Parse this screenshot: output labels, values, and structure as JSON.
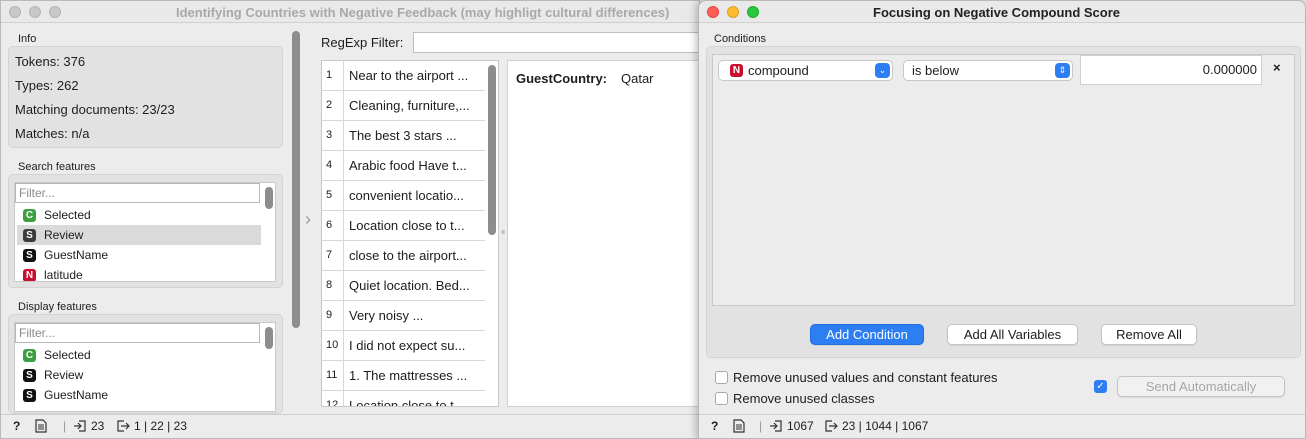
{
  "corpus_viewer": {
    "title": "Identifying Countries with Negative Feedback (may highligt cultural differences)",
    "info": {
      "heading": "Info",
      "tokens": "Tokens: 376",
      "types": "Types: 262",
      "matching_documents": "Matching documents: 23/23",
      "matches": "Matches: n/a"
    },
    "search_features": {
      "heading": "Search features",
      "filter_placeholder": "Filter...",
      "items": [
        {
          "badge": "C",
          "label": "Selected",
          "color": "#3aa041"
        },
        {
          "badge": "S",
          "label": "Review",
          "color": "#3b3b3b"
        },
        {
          "badge": "S",
          "label": "GuestName",
          "color": "#111111"
        },
        {
          "badge": "N",
          "label": "latitude",
          "color": "#c8102e"
        }
      ]
    },
    "display_features": {
      "heading": "Display features",
      "filter_placeholder": "Filter...",
      "items": [
        {
          "badge": "C",
          "label": "Selected",
          "color": "#3aa041"
        },
        {
          "badge": "S",
          "label": "Review",
          "color": "#111111"
        },
        {
          "badge": "S",
          "label": "GuestName",
          "color": "#111111"
        }
      ]
    },
    "regexp_label": "RegExp Filter:",
    "regexp_value": "",
    "documents": [
      {
        "n": "1",
        "text": "Near to the airport ..."
      },
      {
        "n": "2",
        "text": "Cleaning, furniture,..."
      },
      {
        "n": "3",
        "text": "The best 3 stars ..."
      },
      {
        "n": "4",
        "text": "Arabic food Have t..."
      },
      {
        "n": "5",
        "text": "convenient locatio..."
      },
      {
        "n": "6",
        "text": "Location close to t..."
      },
      {
        "n": "7",
        "text": "close to the airport..."
      },
      {
        "n": "8",
        "text": "Quiet location. Bed..."
      },
      {
        "n": "9",
        "text": "Very noisy ..."
      },
      {
        "n": "10",
        "text": "I did not expect su..."
      },
      {
        "n": "11",
        "text": "1. The mattresses ..."
      },
      {
        "n": "12",
        "text": "Location close to t..."
      }
    ],
    "detail": {
      "key": "GuestCountry:",
      "value": "Qatar"
    },
    "status": {
      "input": "23",
      "output": "1 | 22 | 23"
    }
  },
  "select_rows": {
    "title": "Focusing on Negative Compound  Score",
    "conditions_label": "Conditions",
    "condition": {
      "var_badge": "N",
      "var_badge_color": "#c8102e",
      "variable": "compound",
      "operator": "is below",
      "value": "0.000000",
      "remove_glyph": "×"
    },
    "buttons": {
      "add_condition": "Add Condition",
      "add_all_variables": "Add All Variables",
      "remove_all": "Remove All"
    },
    "options": {
      "remove_unused_values": "Remove unused values and constant features",
      "remove_unused_classes": "Remove unused classes",
      "send_automatically": "Send Automatically"
    },
    "status": {
      "input": "1067",
      "output": "23 | 1044 | 1067"
    },
    "accent": "#2c7ef2"
  }
}
